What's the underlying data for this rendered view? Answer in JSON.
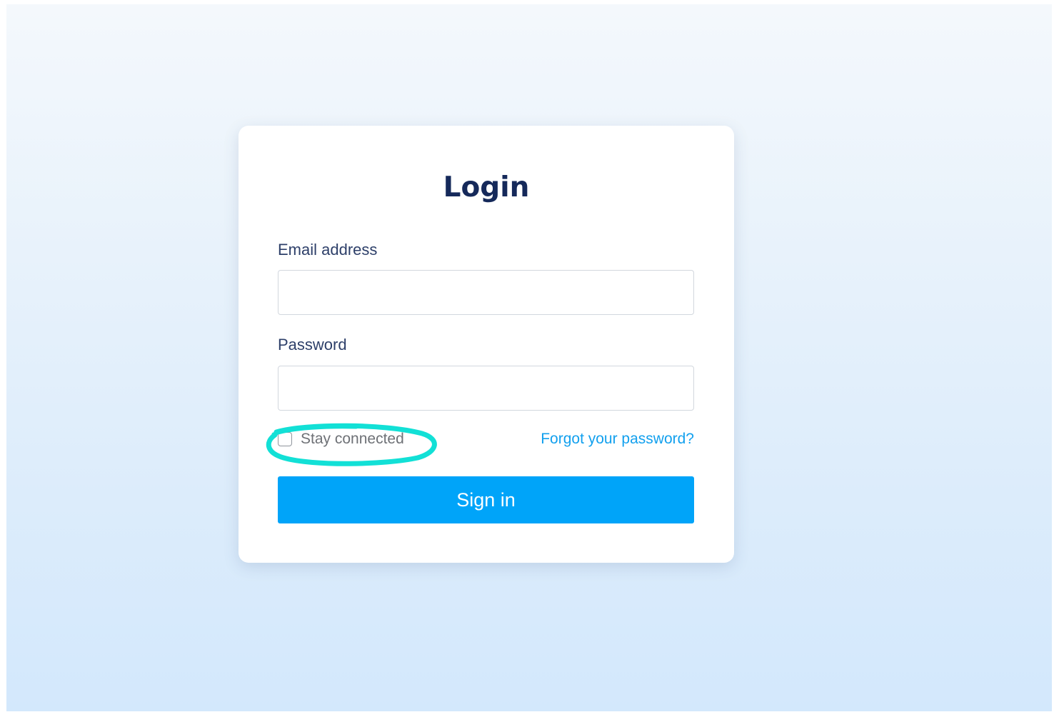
{
  "login": {
    "title": "Login",
    "email_label": "Email address",
    "email_value": "",
    "password_label": "Password",
    "password_value": "",
    "stay_connected_label": "Stay connected",
    "stay_connected_checked": false,
    "forgot_password_link": "Forgot your password?",
    "sign_in_button": "Sign in"
  },
  "annotation": {
    "icon": "hand-drawn-circle",
    "color": "#12e0d6"
  },
  "colors": {
    "title": "#15295a",
    "label": "#2d3f69",
    "link": "#12a0ee",
    "button": "#00a4f9"
  }
}
